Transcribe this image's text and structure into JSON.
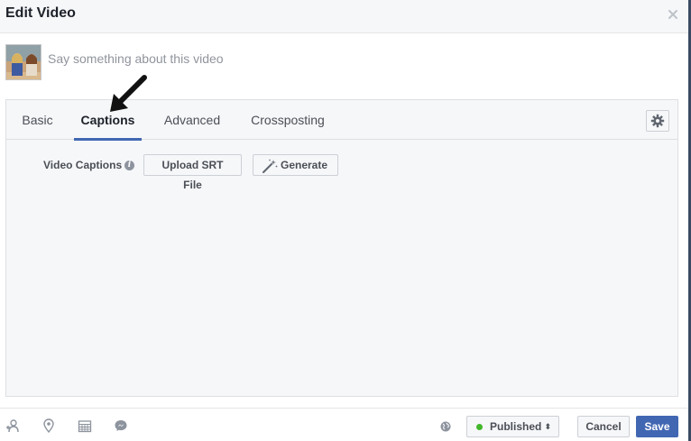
{
  "dialog": {
    "title": "Edit Video",
    "close_icon": "close-icon"
  },
  "composer": {
    "placeholder": "Say something about this video",
    "thumbnail_icon": "video-thumbnail"
  },
  "tabs": [
    {
      "label": "Basic",
      "active": false
    },
    {
      "label": "Captions",
      "active": true
    },
    {
      "label": "Advanced",
      "active": false
    },
    {
      "label": "Crossposting",
      "active": false
    }
  ],
  "settings_icon": "gear-icon",
  "captions": {
    "label": "Video Captions",
    "info_icon": "info-icon",
    "upload_label": "Upload SRT File",
    "generate_label": "Generate",
    "generate_icon": "magic-wand-icon"
  },
  "footer": {
    "icons": [
      "tag-people-icon",
      "location-icon",
      "calendar-icon",
      "messenger-icon"
    ],
    "privacy_icon": "globe-icon",
    "status_label": "Published",
    "status_color": "#42b72a",
    "cancel_label": "Cancel",
    "save_label": "Save"
  },
  "colors": {
    "accent": "#4267b2",
    "published": "#42b72a"
  }
}
